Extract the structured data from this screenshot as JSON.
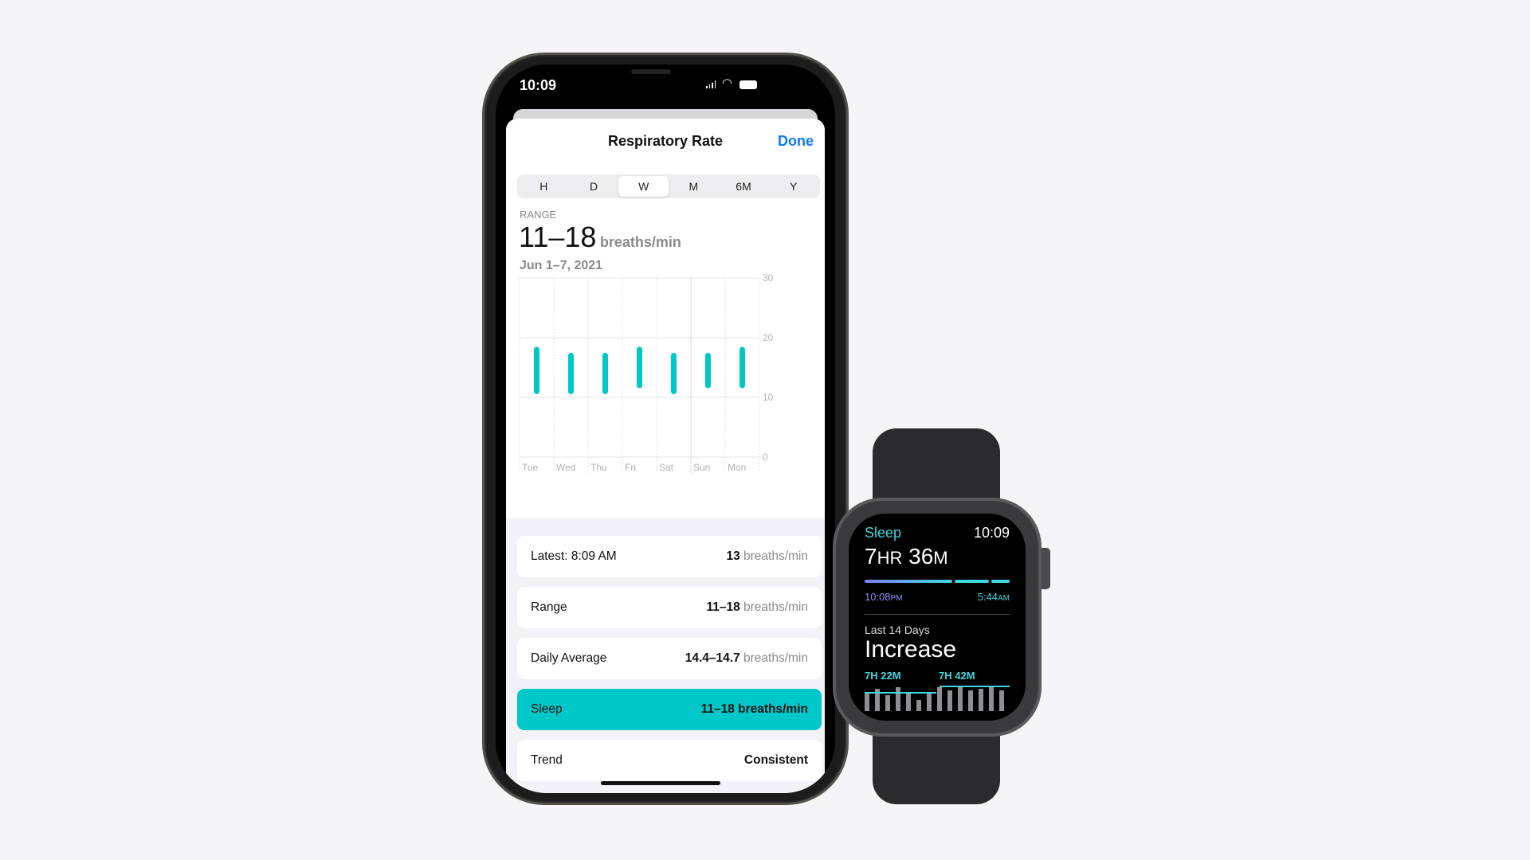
{
  "phone": {
    "status": {
      "time": "10:09"
    },
    "header": {
      "title": "Respiratory Rate",
      "done_label": "Done"
    },
    "segments": [
      "H",
      "D",
      "W",
      "M",
      "6M",
      "Y"
    ],
    "selected_segment": "W",
    "summary": {
      "label": "RANGE",
      "value": "11–18",
      "unit": "breaths/min",
      "date": "Jun 1–7, 2021"
    },
    "rows": [
      {
        "label": "Latest: 8:09 AM",
        "value": "13",
        "unit": "breaths/min"
      },
      {
        "label": "Range",
        "value": "11–18",
        "unit": "breaths/min"
      },
      {
        "label": "Daily Average",
        "value": "14.4–14.7",
        "unit": "breaths/min"
      },
      {
        "label": "Sleep",
        "value": "11–18 breaths/min",
        "unit": ""
      },
      {
        "label": "Trend",
        "value": "Consistent",
        "unit": ""
      }
    ],
    "accent": "#00c8c8",
    "link_color": "#0a7aff"
  },
  "chart_data": {
    "type": "bar",
    "subtype": "range",
    "categories": [
      "Tue",
      "Wed",
      "Thu",
      "Fri",
      "Sat",
      "Sun",
      "Mon"
    ],
    "series": [
      {
        "low": [
          11,
          11,
          11,
          12,
          11,
          12,
          12
        ],
        "high": [
          18,
          17,
          17,
          18,
          17,
          17,
          18
        ]
      }
    ],
    "ylim": [
      0,
      30
    ],
    "yticks": [
      "0",
      "10",
      "20",
      "30"
    ],
    "grid": true,
    "color": "#00c8c8"
  },
  "watch": {
    "title": "Sleep",
    "time": "10:09",
    "duration_h": "7",
    "duration_h_unit": "HR",
    "duration_m": "36",
    "duration_m_unit": "M",
    "start": "10:08",
    "start_ampm": "PM",
    "end": "5:44",
    "end_ampm": "AM",
    "period": "Last 14 Days",
    "trend": "Increase",
    "avg1": "7H 22M",
    "avg2": "7H 42M"
  }
}
